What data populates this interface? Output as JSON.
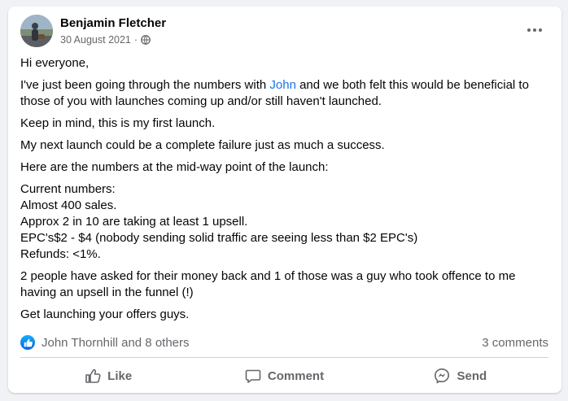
{
  "post": {
    "author": "Benjamin Fletcher",
    "date": "30 August 2021",
    "separator": "·",
    "privacy_icon": "globe-icon",
    "more_icon": "more-options-icon"
  },
  "content": {
    "p1": "Hi everyone,",
    "p2_before": "I've just been going through the numbers with ",
    "p2_mention": "John",
    "p2_after": " and we both felt this would be beneficial to those of you with launches coming up and/or still haven't launched.",
    "p3": "Keep in mind, this is my first launch.",
    "p4": "My next launch could be a complete failure just as much a success.",
    "p5": "Here are the numbers at the mid-way point of the launch:",
    "numbers": [
      "Current numbers:",
      "Almost 400 sales.",
      "Approx 2 in 10 are taking at least 1 upsell.",
      "EPC's$2 - $4 (nobody sending solid traffic are seeing less than $2 EPC's)",
      "Refunds: <1%."
    ],
    "p7": "2 people have asked for their money back and 1 of those was a guy who took offence to me having an upsell in the funnel (!)",
    "p8": "Get launching your offers guys."
  },
  "reactions": {
    "icon": "like-reaction-icon",
    "text": "John Thornhill and 8 others",
    "comments": "3 comments"
  },
  "actions": {
    "like": "Like",
    "comment": "Comment",
    "send": "Send"
  },
  "colors": {
    "link": "#1b74e4",
    "secondary_text": "#65676b",
    "like_blue": "#0866ff"
  }
}
